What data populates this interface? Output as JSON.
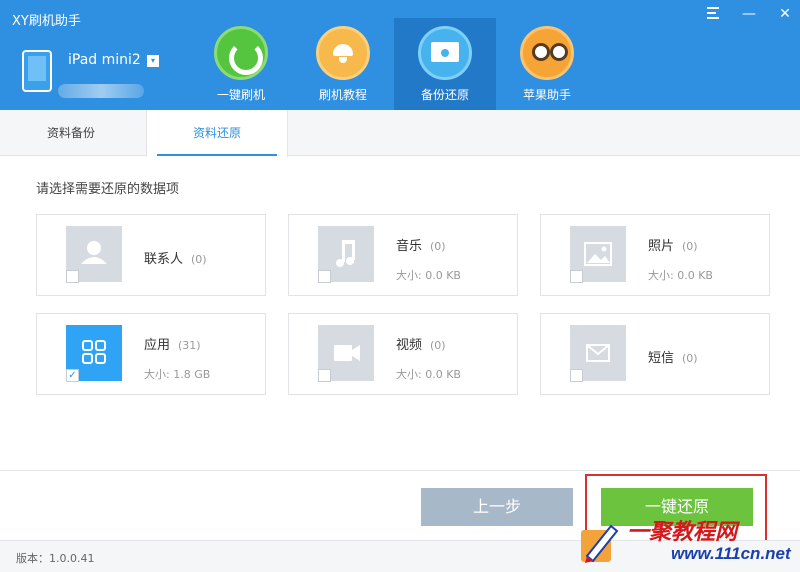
{
  "app": {
    "title": "XY刷机助手"
  },
  "window_controls": {
    "menu_icon": "list-menu-icon",
    "minimize": "—",
    "close": "✕"
  },
  "device": {
    "name": "iPad mini2",
    "dropdown_glyph": "▾"
  },
  "nav": {
    "items": [
      {
        "label": "一键刷机",
        "icon": "refresh-icon"
      },
      {
        "label": "刷机教程",
        "icon": "lamp-icon"
      },
      {
        "label": "备份还原",
        "icon": "disk-icon",
        "active": true
      },
      {
        "label": "苹果助手",
        "icon": "owl-icon"
      }
    ]
  },
  "tabs": {
    "backup": "资料备份",
    "restore": "资料还原"
  },
  "content": {
    "prompt": "请选择需要还原的数据项",
    "cards": [
      {
        "name": "联系人",
        "count": "(0)",
        "size": "",
        "icon": "contact-icon",
        "checked": false
      },
      {
        "name": "音乐",
        "count": "(0)",
        "size": "大小: 0.0 KB",
        "icon": "music-icon",
        "checked": false
      },
      {
        "name": "照片",
        "count": "(0)",
        "size": "大小: 0.0 KB",
        "icon": "photo-icon",
        "checked": false
      },
      {
        "name": "应用",
        "count": "(31)",
        "size": "大小: 1.8 GB",
        "icon": "apps-icon",
        "checked": true
      },
      {
        "name": "视频",
        "count": "(0)",
        "size": "大小: 0.0 KB",
        "icon": "video-icon",
        "checked": false
      },
      {
        "name": "短信",
        "count": "(0)",
        "size": "",
        "icon": "message-icon",
        "checked": false
      }
    ],
    "checkmark": "✓"
  },
  "buttons": {
    "prev": "上一步",
    "restore": "一键还原"
  },
  "status": {
    "version": "版本：1.0.0.41"
  },
  "watermark": {
    "brand": "一聚教程网",
    "url": "www.111cn.net"
  },
  "colors": {
    "header": "#2f8fe0",
    "accent": "#2f8fe0",
    "restore_button": "#6cc33e",
    "prev_button": "#a7b8c9",
    "highlight_box": "#d93030"
  }
}
